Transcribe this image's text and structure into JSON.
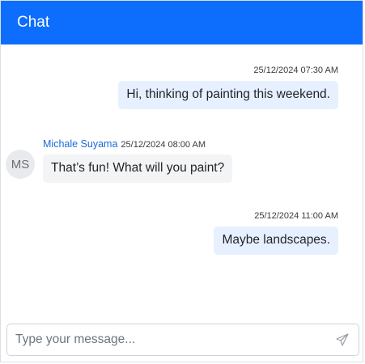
{
  "header": {
    "title": "Chat"
  },
  "messages": [
    {
      "direction": "outgoing",
      "timestamp": "25/12/2024 07:30 AM",
      "text": "Hi, thinking of painting this weekend."
    },
    {
      "direction": "incoming",
      "sender": "Michale Suyama",
      "avatar_initials": "MS",
      "timestamp": "25/12/2024 08:00 AM",
      "text": "That’s fun! What will you paint?"
    },
    {
      "direction": "outgoing",
      "timestamp": "25/12/2024 11:00 AM",
      "text": "Maybe landscapes."
    }
  ],
  "composer": {
    "placeholder": "Type your message...",
    "send_icon": "send-icon"
  },
  "colors": {
    "header_bg": "#0d6efd",
    "outgoing_bubble": "#e7f0ff",
    "incoming_bubble": "#f3f4f6",
    "sender_name": "#1a6bd8"
  }
}
